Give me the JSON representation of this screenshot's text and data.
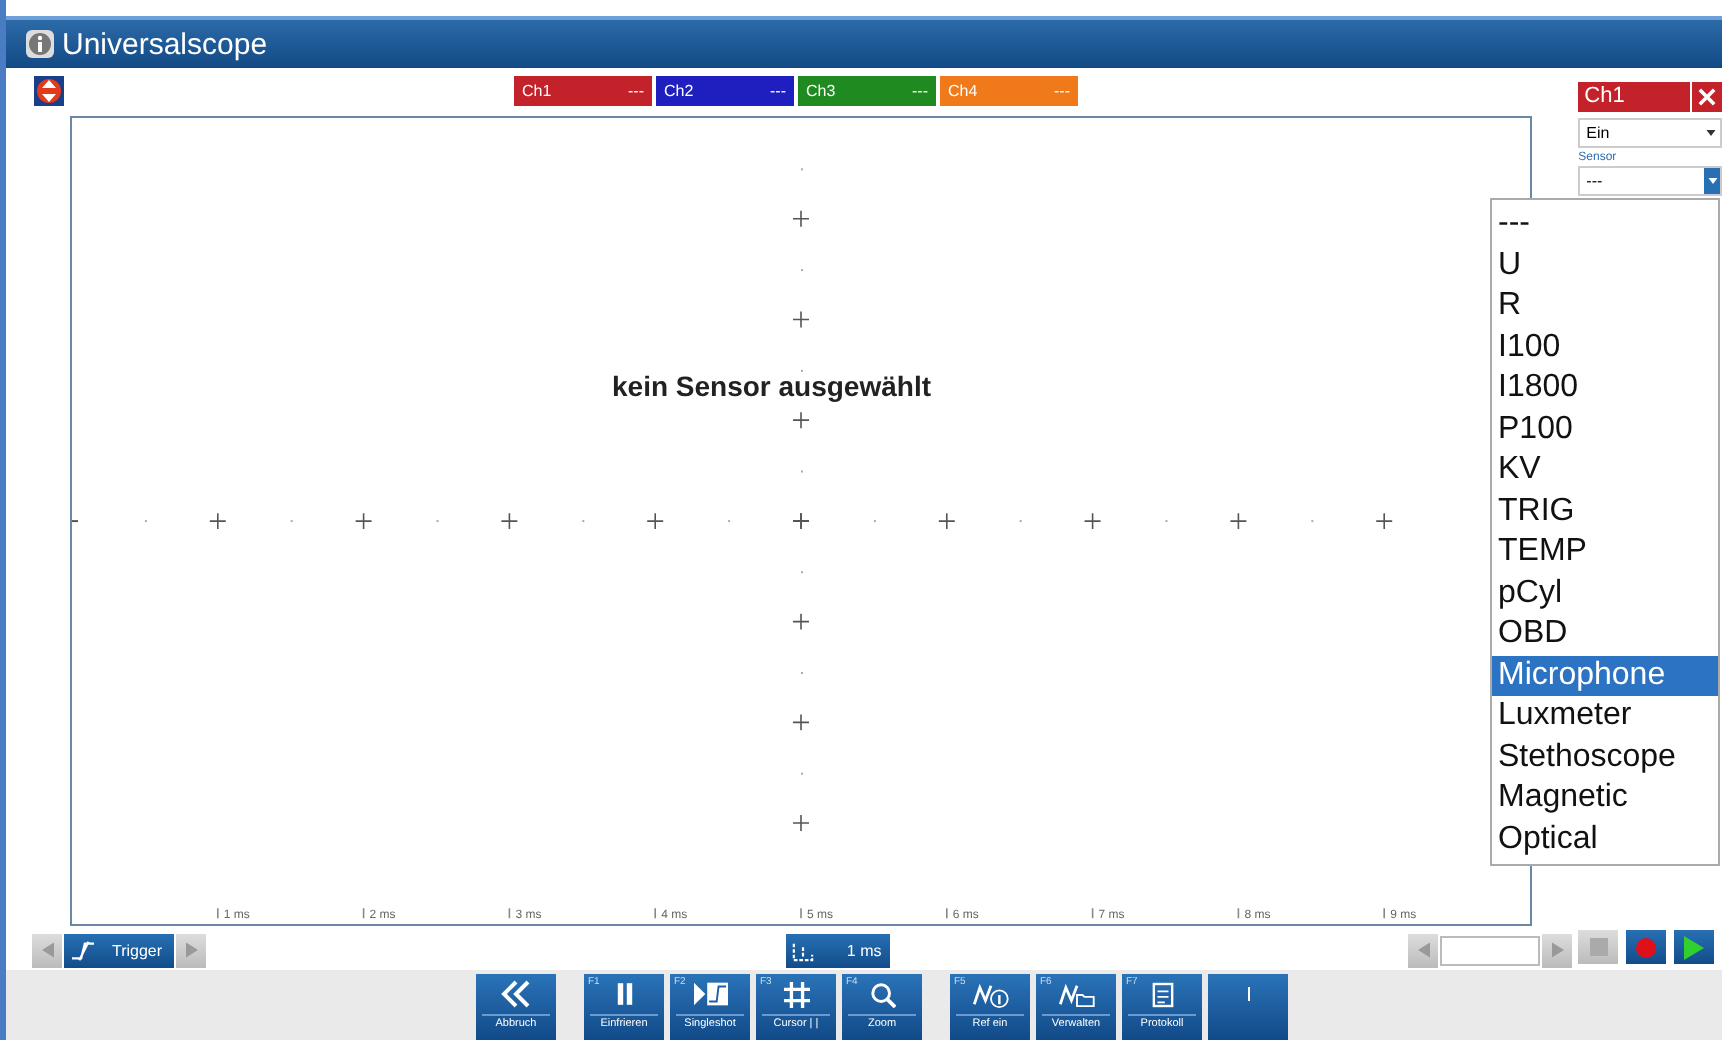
{
  "window": {
    "title": "Universalscope"
  },
  "channels": [
    {
      "label": "Ch1",
      "value": "---",
      "color": "#c4222a"
    },
    {
      "label": "Ch2",
      "value": "---",
      "color": "#1f1fc0"
    },
    {
      "label": "Ch3",
      "value": "---",
      "color": "#1f8a1f"
    },
    {
      "label": "Ch4",
      "value": "---",
      "color": "#f07a1a"
    }
  ],
  "plot": {
    "message": "kein Sensor ausgewählt",
    "time_labels": [
      "1 ms",
      "2 ms",
      "3 ms",
      "4 ms",
      "5 ms",
      "6 ms",
      "7 ms",
      "8 ms",
      "9 ms"
    ]
  },
  "controls": {
    "trigger": "Trigger",
    "timebase": "1 ms"
  },
  "toolbar": [
    [
      {
        "kind": "back",
        "label": "Abbruch"
      }
    ],
    [
      {
        "kind": "pause",
        "key": "F1",
        "label": "Einfrieren"
      },
      {
        "kind": "singleshot",
        "key": "F2",
        "label": "Singleshot"
      },
      {
        "kind": "cursor",
        "key": "F3",
        "label": "Cursor | |"
      },
      {
        "kind": "zoom",
        "key": "F4",
        "label": "Zoom"
      }
    ],
    [
      {
        "kind": "ref",
        "key": "F5",
        "label": "Ref ein"
      },
      {
        "kind": "manage",
        "key": "F6",
        "label": "Verwalten"
      },
      {
        "kind": "report",
        "key": "F7",
        "label": "Protokoll"
      },
      {
        "kind": "blank"
      }
    ]
  ],
  "channel_panel": {
    "title": "Ch1",
    "mode": "Ein",
    "sensor_label": "Sensor",
    "sensor_value": "---"
  },
  "sensor_options": [
    {
      "label": "---",
      "selected": false
    },
    {
      "label": "U",
      "selected": false
    },
    {
      "label": "R",
      "selected": false
    },
    {
      "label": "I100",
      "selected": false
    },
    {
      "label": "I1800",
      "selected": false
    },
    {
      "label": "P100",
      "selected": false
    },
    {
      "label": "KV",
      "selected": false
    },
    {
      "label": "TRIG",
      "selected": false
    },
    {
      "label": "TEMP",
      "selected": false
    },
    {
      "label": "pCyl",
      "selected": false
    },
    {
      "label": "OBD",
      "selected": false
    },
    {
      "label": "Microphone",
      "selected": true
    },
    {
      "label": "Luxmeter",
      "selected": false
    },
    {
      "label": "Stethoscope",
      "selected": false
    },
    {
      "label": "Magnetic",
      "selected": false
    },
    {
      "label": "Optical",
      "selected": false
    }
  ]
}
